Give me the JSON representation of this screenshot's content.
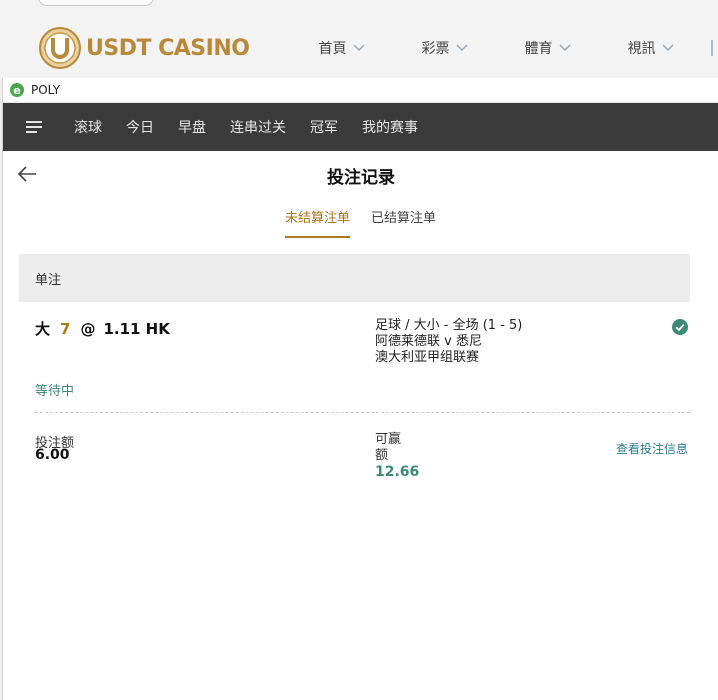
{
  "site": {
    "logo_text": "USDT CASINO",
    "logo_letter": "U",
    "nav": [
      {
        "label": "首頁"
      },
      {
        "label": "彩票"
      },
      {
        "label": "體育"
      },
      {
        "label": "視訊"
      }
    ],
    "accent_gold": "#b8893a"
  },
  "window": {
    "title": "POLY",
    "icon": "ie-browser-icon"
  },
  "topnav": {
    "items": [
      "滚球",
      "今日",
      "早盘",
      "连串过关",
      "冠军",
      "我的赛事"
    ]
  },
  "page": {
    "title": "投注记录",
    "tabs": [
      {
        "label": "未结算注单",
        "active": true
      },
      {
        "label": "已结算注单",
        "active": false
      }
    ]
  },
  "section": {
    "label": "单注"
  },
  "bet": {
    "selection": "大",
    "line": "7",
    "at": "@",
    "odds": "1.11 HK",
    "market": "足球 / 大小 - 全场 (1 - 5)",
    "match": "阿德莱德联 v 悉尼",
    "league": "澳大利亚甲组联赛",
    "status": "等待中",
    "stake_label": "投注额",
    "stake_value": "6.00",
    "win_label": "可赢额",
    "win_value": "12.66",
    "view_link": "查看投注信息"
  },
  "colors": {
    "gold": "#a9771c",
    "green": "#3a8a76",
    "nav_bg": "#3b3b3b",
    "section_bg": "#ececec",
    "link": "#2a7c8a"
  }
}
